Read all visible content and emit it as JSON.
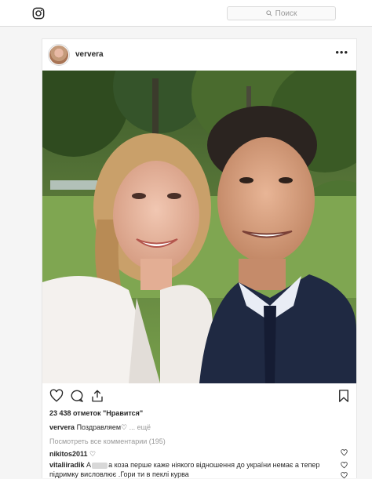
{
  "header": {
    "search_placeholder": "Поиск",
    "icons": [
      "instagram-icon",
      "search-icon"
    ]
  },
  "post": {
    "username": "ververa",
    "more_label": "•••",
    "likes": "23 438 отметок \"Нравится\"",
    "caption": {
      "username": "ververa",
      "text": "Поздравляем♡",
      "more": "... ещё"
    },
    "view_all_comments": "Посмотреть все комментарии (195)",
    "comments": [
      {
        "username": "nikitos2011",
        "text": "♡"
      },
      {
        "username": "vitaliiradik",
        "text_before": "А",
        "text_after": "а коза перше каже ніякого відношення до україни немає а тепер",
        "text_line2": "підримку висловлює .Гори ти в пеклі курва"
      }
    ]
  },
  "colors": {
    "border": "#dbdbdb",
    "text": "#262626",
    "muted": "#999999"
  }
}
